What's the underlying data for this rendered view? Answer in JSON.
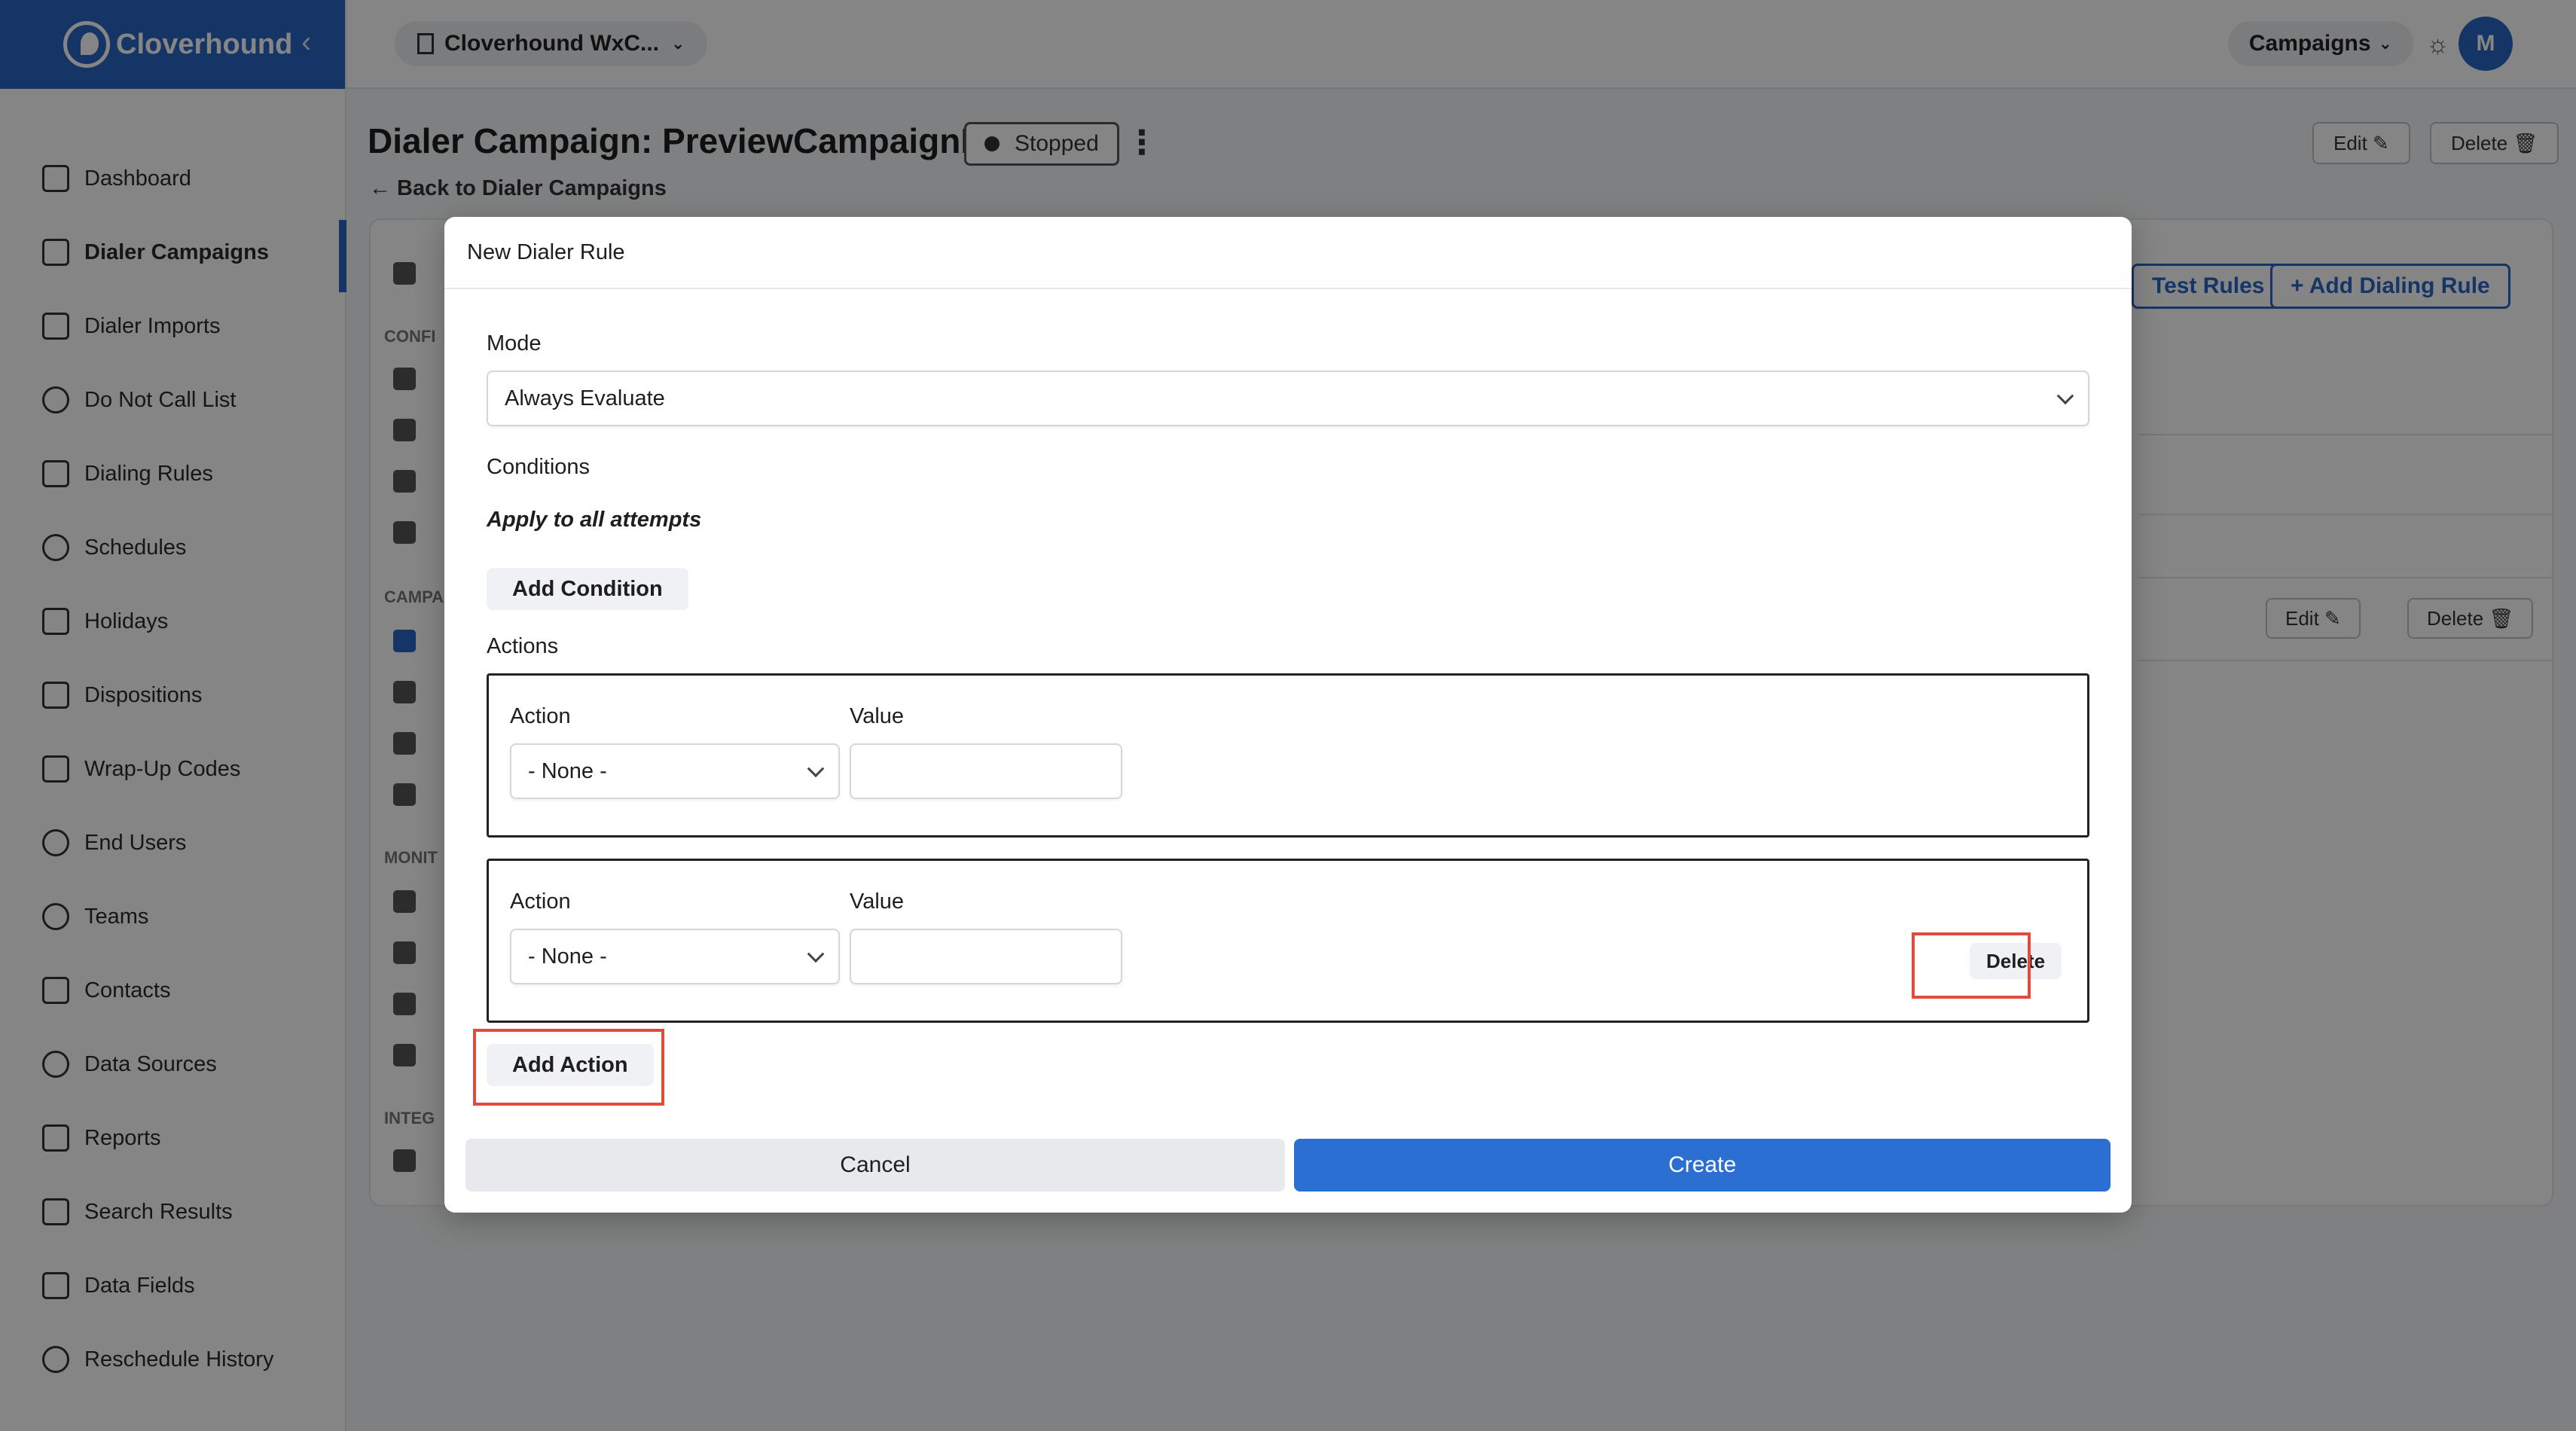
{
  "app": {
    "name": "Cloverhound",
    "collapse_glyph": "‹"
  },
  "sidebar": {
    "items": [
      {
        "label": "Dashboard",
        "icon": "dashboard-icon"
      },
      {
        "label": "Dialer Campaigns",
        "icon": "megaphone-icon",
        "active": true
      },
      {
        "label": "Dialer Imports",
        "icon": "import-icon"
      },
      {
        "label": "Do Not Call List",
        "icon": "block-icon"
      },
      {
        "label": "Dialing Rules",
        "icon": "shield-icon"
      },
      {
        "label": "Schedules",
        "icon": "clock-icon"
      },
      {
        "label": "Holidays",
        "icon": "calendar-icon"
      },
      {
        "label": "Dispositions",
        "icon": "clipboard-icon"
      },
      {
        "label": "Wrap-Up Codes",
        "icon": "wrapup-icon"
      },
      {
        "label": "End Users",
        "icon": "headset-icon"
      },
      {
        "label": "Teams",
        "icon": "team-icon"
      },
      {
        "label": "Contacts",
        "icon": "contact-card-icon"
      },
      {
        "label": "Data Sources",
        "icon": "cloud-icon"
      },
      {
        "label": "Reports",
        "icon": "report-icon"
      },
      {
        "label": "Search Results",
        "icon": "search-doc-icon"
      },
      {
        "label": "Data Fields",
        "icon": "table-icon"
      },
      {
        "label": "Reschedule History",
        "icon": "history-icon"
      }
    ]
  },
  "topbar": {
    "tenant": "Cloverhound WxC...",
    "campaigns_menu": "Campaigns",
    "theme_glyph": "☼",
    "avatar_initial": "M"
  },
  "page": {
    "title": "Dialer Campaign: PreviewCampaignM",
    "status": "Stopped",
    "kebab_glyph": "⋮",
    "back_link": "← Back to Dialer Campaigns",
    "edit_label": "Edit ✎",
    "delete_label": "Delete 🗑",
    "test_rules_label": "Test Rules",
    "add_dialing_rule_label": "+  Add Dialing Rule",
    "side_sections": [
      "CONFI",
      "CAMPA",
      "MONIT",
      "INTEG"
    ]
  },
  "modal": {
    "title": "New Dialer Rule",
    "mode_label": "Mode",
    "mode_value": "Always Evaluate",
    "conditions_label": "Conditions",
    "conditions_text": "Apply to all attempts",
    "add_condition_label": "Add Condition",
    "actions_label": "Actions",
    "action_rows": [
      {
        "action_label": "Action",
        "value_label": "Value",
        "action_value": "- None -",
        "value": ""
      },
      {
        "action_label": "Action",
        "value_label": "Value",
        "action_value": "- None -",
        "value": "",
        "delete_label": "Delete"
      }
    ],
    "add_action_label": "Add Action",
    "cancel_label": "Cancel",
    "create_label": "Create",
    "highlight_color": "#e24a3b"
  }
}
